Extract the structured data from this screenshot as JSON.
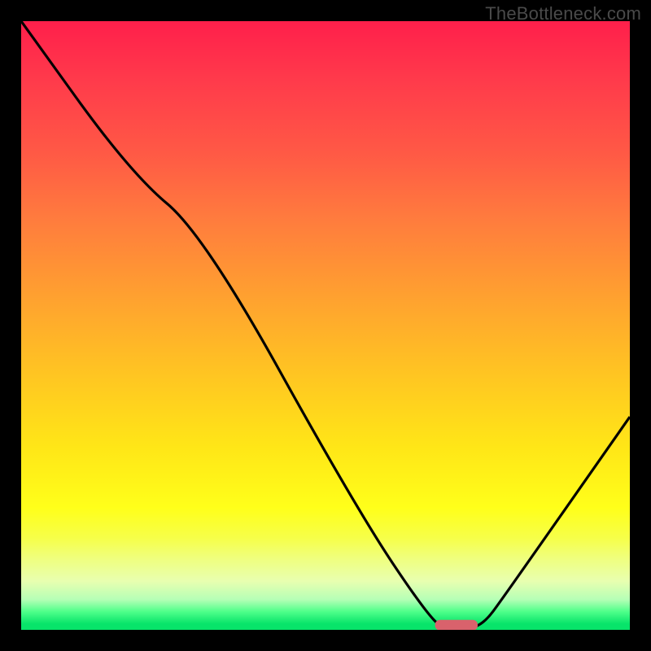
{
  "watermark": "TheBottleneck.com",
  "chart_data": {
    "type": "line",
    "title": "",
    "xlabel": "",
    "ylabel": "",
    "xlim": [
      0,
      100
    ],
    "ylim": [
      0,
      100
    ],
    "series": [
      {
        "name": "bottleneck-curve",
        "x": [
          0,
          18,
          30,
          55,
          67,
          70,
          73,
          76,
          79,
          100
        ],
        "y": [
          100,
          75,
          65,
          20,
          2,
          0,
          0,
          1,
          5,
          35
        ]
      }
    ],
    "marker": {
      "name": "optimal-range",
      "x_center": 71.5,
      "y": 0.5,
      "width": 7,
      "color": "#d9626c"
    },
    "gradient_note": "background encodes bottleneck severity: red=high, green=low"
  }
}
